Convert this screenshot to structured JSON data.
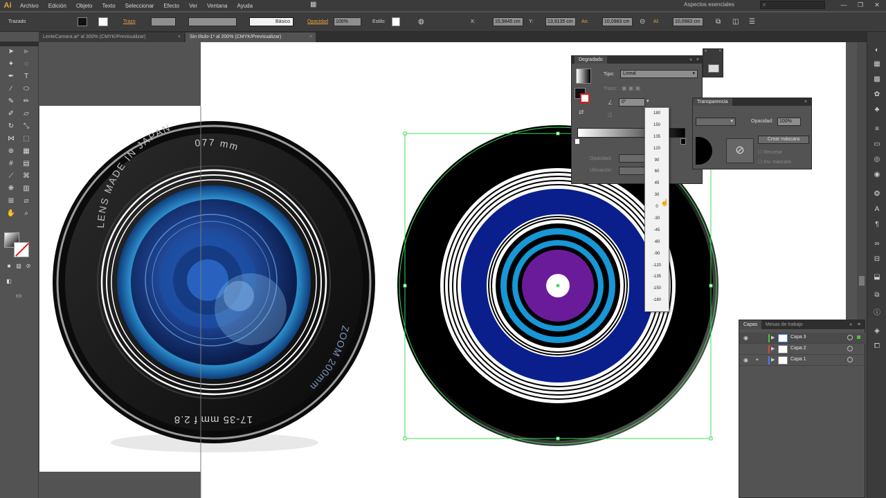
{
  "app": {
    "logo": "Ai",
    "workspace": "Aspectos esenciales",
    "search_placeholder": ""
  },
  "menu": [
    "Archivo",
    "Edición",
    "Objeto",
    "Texto",
    "Seleccionar",
    "Efecto",
    "Ver",
    "Ventana",
    "Ayuda"
  ],
  "window_controls": {
    "minimize": "—",
    "maximize": "❐",
    "close": "✕"
  },
  "controlbar": {
    "selection_label": "Trazado",
    "stroke_label": "Trazo",
    "stroke_style": "Básico",
    "opacity_label": "Opacidad",
    "opacity_value": "100%",
    "style_label": "Estilo:",
    "x_label": "X:",
    "x_value": "15,9845 cm",
    "y_label": "Y:",
    "y_value": "13,9135 cm",
    "w_label": "An:",
    "w_value": "10,0983 cm",
    "h_label": "Al:",
    "h_value": "10,0983 cm"
  },
  "tabs": [
    {
      "label": "LenteCamara.ai* al 300% (CMYK/Previsualizar)",
      "active": false
    },
    {
      "label": "Sin título-1* al 200% (CMYK/Previsualizar)",
      "active": true
    }
  ],
  "lens_text": {
    "made_in": "LENS MADE IN JAPAN",
    "diameter": "077 mm",
    "zoom": "ZOOM 200mm",
    "range": "17-35 mm",
    "aperture": "f 2.8"
  },
  "gradient_panel": {
    "title": "Degradado",
    "type_label": "Tipo:",
    "type_value": "Lineal",
    "stroke_label": "Trazo:",
    "angle_value": "0°",
    "opacity_label": "Opacidad:",
    "location_label": "Ubicación:"
  },
  "angle_options": [
    "180",
    "150",
    "135",
    "120",
    "90",
    "60",
    "45",
    "30",
    "0",
    "-30",
    "-45",
    "-60",
    "-90",
    "-120",
    "-135",
    "-150",
    "-180"
  ],
  "transparency_panel": {
    "title": "Transparencia",
    "opacity_label": "Opacidad:",
    "opacity_value": "100%",
    "make_mask": "Crear máscara",
    "clip": "Recortar",
    "invert_mask": "Inv. máscara"
  },
  "layers_panel": {
    "tab_layers": "Capas",
    "tab_artboards": "Mesas de trabajo",
    "layers": [
      {
        "name": "Capa 3",
        "color": "#4fc43a",
        "locked": false
      },
      {
        "name": "Capa 2",
        "color": "#e04545",
        "locked": false
      },
      {
        "name": "Capa 1",
        "color": "#4a7bff",
        "locked": true
      }
    ]
  },
  "colors": {
    "selection": "#3ddc5a",
    "record_blue": "#0b1f8c",
    "record_cyan": "#1797d6",
    "record_purple": "#6a1b9a",
    "lens_blue": "#1e90d8"
  }
}
